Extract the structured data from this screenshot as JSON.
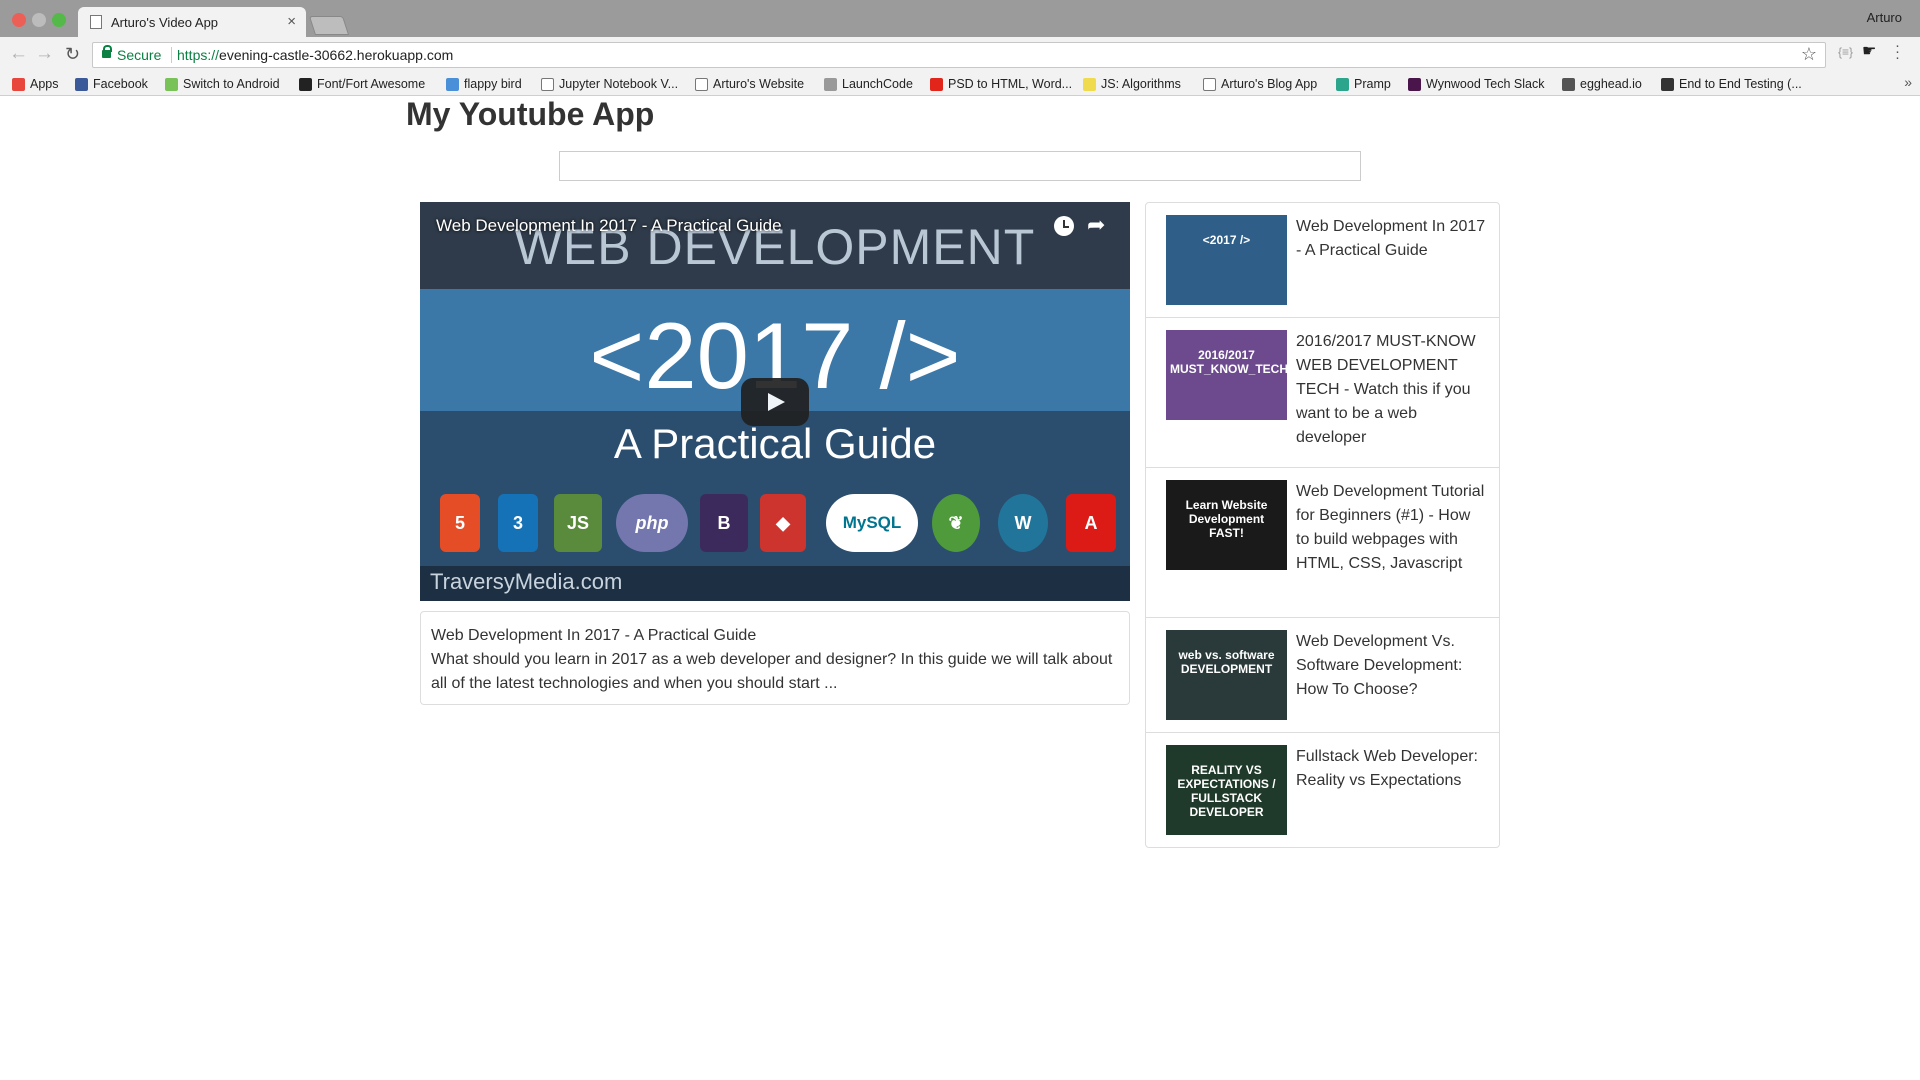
{
  "browser": {
    "tab_title": "Arturo's Video App",
    "tab_close": "×",
    "profile_name": "Arturo",
    "secure_label": "Secure",
    "url_scheme": "https://",
    "url_host": "evening-castle-30662.herokuapp.com",
    "bookmarks": [
      {
        "label": "Apps",
        "icon": "apps-grid-icon",
        "color": "#e8453c"
      },
      {
        "label": "Facebook",
        "icon": "facebook-icon",
        "color": "#3b5998"
      },
      {
        "label": "Switch to Android",
        "icon": "android-icon",
        "color": "#78c257"
      },
      {
        "label": "Font/Fort Awesome",
        "icon": "font-awesome-icon",
        "color": "#222222"
      },
      {
        "label": "flappy bird",
        "icon": "flappy-bird-icon",
        "color": "#4a90d9"
      },
      {
        "label": "Jupyter Notebook V...",
        "icon": "page-icon",
        "color": "#ffffff"
      },
      {
        "label": "Arturo's Website",
        "icon": "page-icon",
        "color": "#ffffff"
      },
      {
        "label": "LaunchCode",
        "icon": "launchcode-icon",
        "color": "#999999"
      },
      {
        "label": "PSD to HTML, Word...",
        "icon": "psd-icon",
        "color": "#e1251b"
      },
      {
        "label": "JS: Algorithms",
        "icon": "js-icon",
        "color": "#f0db4f"
      },
      {
        "label": "Arturo's Blog App",
        "icon": "page-icon",
        "color": "#ffffff"
      },
      {
        "label": "Pramp",
        "icon": "pramp-icon",
        "color": "#2ca58d"
      },
      {
        "label": "Wynwood Tech Slack",
        "icon": "slack-icon",
        "color": "#4a154b"
      },
      {
        "label": "egghead.io",
        "icon": "egghead-icon",
        "color": "#555555"
      },
      {
        "label": "End to End Testing (...",
        "icon": "testing-icon",
        "color": "#333333"
      }
    ]
  },
  "app": {
    "title": "My Youtube App",
    "search": {
      "value": "",
      "placeholder": ""
    }
  },
  "player": {
    "overlay_title": "Web Development In 2017 - A Practical Guide",
    "thumbnail": {
      "headline": "WEB DEVELOPMENT",
      "year": "<2017 />",
      "subtitle": "A Practical Guide",
      "footer": "TraversyMedia.com",
      "logos": [
        {
          "label": "5",
          "icon": "html5-icon",
          "color": "#e44d26"
        },
        {
          "label": "3",
          "icon": "css3-icon",
          "color": "#1572b6"
        },
        {
          "label": "JS",
          "icon": "nodejs-icon",
          "color": "#5a8a3c"
        },
        {
          "label": "php",
          "icon": "php-icon",
          "color": "#7377ad"
        },
        {
          "label": "B",
          "icon": "bootstrap-icon",
          "color": "#3d2a5c"
        },
        {
          "label": "◆",
          "icon": "ruby-icon",
          "color": "#cc342d"
        },
        {
          "label": "MySQL",
          "icon": "mysql-icon",
          "color": "#ffffff"
        },
        {
          "label": "❦",
          "icon": "mongodb-icon",
          "color": "#4f9a3b"
        },
        {
          "label": "W",
          "icon": "wordpress-icon",
          "color": "#21759b"
        },
        {
          "label": "A",
          "icon": "angular-icon",
          "color": "#dd1b16"
        }
      ]
    }
  },
  "selected_video": {
    "title": "Web Development In 2017 - A Practical Guide",
    "description": "What should you learn in 2017 as a web developer and designer? In this guide we will talk about all of the latest technologies and when you should start ..."
  },
  "video_list": [
    {
      "title": "Web Development In 2017 - A Practical Guide",
      "thumb_text": "<2017 />",
      "thumb_bg": "#2f5f88"
    },
    {
      "title": "2016/2017 MUST-KNOW WEB DEVELOPMENT TECH - Watch this if you want to be a web developer",
      "thumb_text": "2016/2017 MUST_KNOW_TECH",
      "thumb_bg": "#6d4a8e"
    },
    {
      "title": "Web Development Tutorial for Beginners (#1) - How to build webpages with HTML, CSS, Javascript",
      "thumb_text": "Learn Website Development FAST!",
      "thumb_bg": "#1a1a1a"
    },
    {
      "title": "Web Development Vs. Software Development: How To Choose?",
      "thumb_text": "web vs. software DEVELOPMENT",
      "thumb_bg": "#2a3a3a"
    },
    {
      "title": "Fullstack Web Developer: Reality vs Expectations",
      "thumb_text": "REALITY VS EXPECTATIONS / FULLSTACK DEVELOPER",
      "thumb_bg": "#1f3a2a"
    }
  ]
}
